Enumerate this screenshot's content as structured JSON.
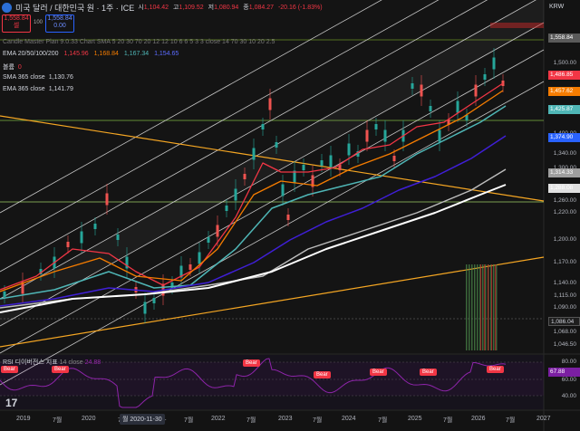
{
  "header": {
    "title": "미국 달러 / 대한민국 원 · 1주 · ICE",
    "ohlc": [
      {
        "label": "시",
        "value": "1,104.42"
      },
      {
        "label": "고",
        "value": "1,109.52"
      },
      {
        "label": "저",
        "value": "1,080.94"
      },
      {
        "label": "종",
        "value": "1,084.27"
      },
      {
        "label": "",
        "value": "-20.16 (-1.83%)"
      }
    ]
  },
  "trade": {
    "sell_price": "1,558.84",
    "sell_label": "셀",
    "qty": "100",
    "buy_price": "1,558.84",
    "buy_label": "0.00"
  },
  "legend": {
    "strategy": "Candle Master Plan 9.0.33 Chart SMA 5 20 30 70 20 12 12 10 6 6 5 3 3 close 14 70 30 10 20 2.5",
    "ema_label": "EMA 20/50/100/200",
    "ema_values": [
      "1,145.96",
      "1,168.84",
      "1,167.34",
      "1,154.65"
    ],
    "signal_label": "볼륨",
    "signal_value": "0",
    "sma_label": "SMA 365 close",
    "sma_value": "1,130.76",
    "ema365_label": "EMA 365 close",
    "ema365_value": "1,141.79"
  },
  "rsi": {
    "label": "RSI 디이버전스 지표",
    "params": "14 close",
    "value": "24.88",
    "current": "67.88",
    "levels": [
      "80.00",
      "60.00",
      "40.00"
    ],
    "bear_label": "Bear"
  },
  "price_axis": {
    "currency": "KRW",
    "ticks": [
      "1,500.00",
      "1,400.00",
      "1,340.00",
      "1,300.00",
      "1,260.00",
      "1,220.00",
      "1,200.00",
      "1,170.00",
      "1,140.00",
      "1,115.00",
      "1,090.00",
      "1,068.00",
      "1,046.50"
    ],
    "labels": [
      {
        "text": "1,558.84",
        "color": "#5a5a5a"
      },
      {
        "text": "1,486.85",
        "color": "#f23645"
      },
      {
        "text": "1,457.62",
        "color": "#f57c00"
      },
      {
        "text": "1,425.87",
        "color": "#4fb6b6"
      },
      {
        "text": "1,374.90",
        "color": "#2962ff"
      },
      {
        "text": "1,314.33",
        "color": "#9e9e9e"
      },
      {
        "text": "1,288.08",
        "color": "#e0e0e0"
      },
      {
        "text": "1,086.04",
        "color": "#1e1e1e"
      }
    ]
  },
  "time_axis": {
    "labels": [
      "2019",
      "7월",
      "2020",
      "7월",
      "2021",
      "7월",
      "2022",
      "7월",
      "2023",
      "7월",
      "2024",
      "7월",
      "2025",
      "7월",
      "2026",
      "7월",
      "2027"
    ],
    "selected": "월 2020-11-30"
  },
  "colors": {
    "ema20": "#f23645",
    "ema50": "#f57c00",
    "ema100": "#4fb6b6",
    "ema200": "#3f1fd6",
    "sma365": "#bdbdbd",
    "ema365": "#ffffff",
    "trend": "#f5a623",
    "channel": "#e6e6e6",
    "rsi": "#7b1fa2",
    "up": "#26a69a",
    "down": "#ef5350"
  }
}
